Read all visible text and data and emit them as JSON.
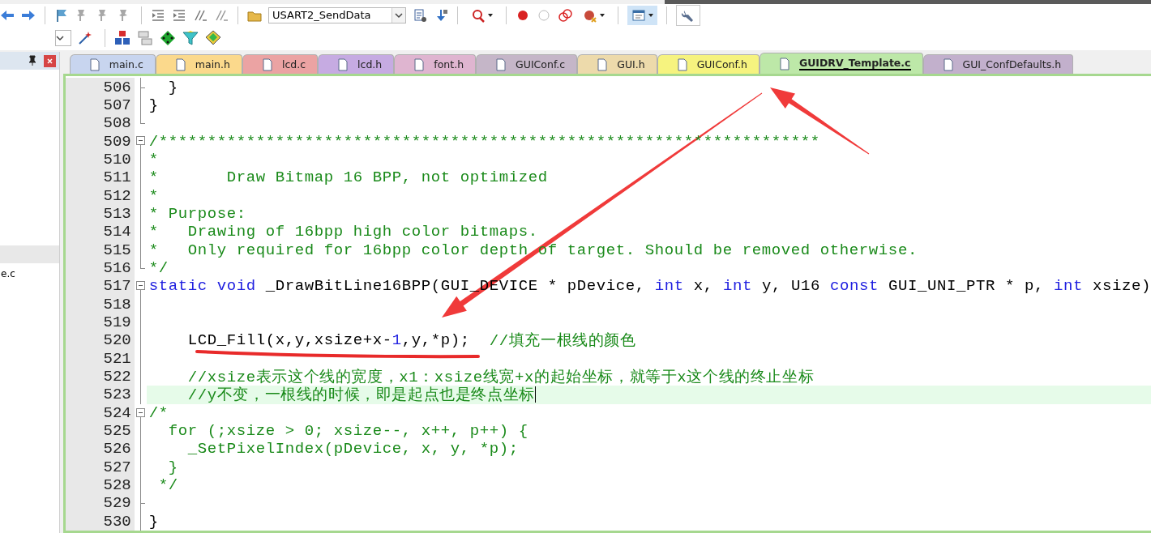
{
  "toolbar": {
    "target": "USART2_SendData",
    "view_toggle_pressed": true
  },
  "project_panel": {
    "items": [
      {
        "label": "e.c"
      }
    ]
  },
  "tabs": [
    {
      "label": "main.c",
      "color": "#c8d5ef",
      "selected": false
    },
    {
      "label": "main.h",
      "color": "#fbd98c",
      "selected": false
    },
    {
      "label": "lcd.c",
      "color": "#eba3a3",
      "selected": false
    },
    {
      "label": "lcd.h",
      "color": "#c6abe2",
      "selected": false
    },
    {
      "label": "font.h",
      "color": "#dfb5d0",
      "selected": false
    },
    {
      "label": "GUIConf.c",
      "color": "#c5b6c8",
      "selected": false
    },
    {
      "label": "GUI.h",
      "color": "#eddaab",
      "selected": false
    },
    {
      "label": "GUIConf.h",
      "color": "#f6f37f",
      "selected": false
    },
    {
      "label": "GUIDRV_Template.c",
      "color": "#bde8a8",
      "selected": true
    },
    {
      "label": "GUI_ConfDefaults.h",
      "color": "#c2b0cc",
      "selected": false
    }
  ],
  "editor": {
    "lines": [
      {
        "number": "506",
        "kind": "tick",
        "current": false,
        "tokens": [
          {
            "kind": "plain",
            "text": "  }"
          }
        ]
      },
      {
        "number": "507",
        "kind": "line",
        "current": false,
        "tokens": [
          {
            "kind": "plain",
            "text": "}"
          }
        ]
      },
      {
        "number": "508",
        "kind": "end",
        "current": false
      },
      {
        "number": "509",
        "kind": "open",
        "current": false,
        "tokens": [
          {
            "kind": "comment",
            "text": "/********************************************************************"
          }
        ]
      },
      {
        "number": "510",
        "kind": "line",
        "current": false,
        "tokens": [
          {
            "kind": "comment",
            "text": "*"
          }
        ]
      },
      {
        "number": "511",
        "kind": "line",
        "current": false,
        "tokens": [
          {
            "kind": "comment",
            "text": "*       Draw Bitmap 16 BPP, not optimized"
          }
        ]
      },
      {
        "number": "512",
        "kind": "line",
        "current": false,
        "tokens": [
          {
            "kind": "comment",
            "text": "*"
          }
        ]
      },
      {
        "number": "513",
        "kind": "line",
        "current": false,
        "tokens": [
          {
            "kind": "comment",
            "text": "* Purpose:"
          }
        ]
      },
      {
        "number": "514",
        "kind": "line",
        "current": false,
        "tokens": [
          {
            "kind": "comment",
            "text": "*   Drawing of 16bpp high color bitmaps."
          }
        ]
      },
      {
        "number": "515",
        "kind": "line",
        "current": false,
        "tokens": [
          {
            "kind": "comment",
            "text": "*   Only required for 16bpp color depth of target. Should be removed otherwise."
          }
        ]
      },
      {
        "number": "516",
        "kind": "end",
        "current": false,
        "tokens": [
          {
            "kind": "comment",
            "text": "*/"
          }
        ]
      },
      {
        "number": "517",
        "kind": "open",
        "current": false,
        "tokens": [
          {
            "kind": "keyword",
            "text": "static void"
          },
          {
            "kind": "plain",
            "text": " _DrawBitLine16BPP(GUI_DEVICE * pDevice, "
          },
          {
            "kind": "keyword",
            "text": "int"
          },
          {
            "kind": "plain",
            "text": " x, "
          },
          {
            "kind": "keyword",
            "text": "int"
          },
          {
            "kind": "plain",
            "text": " y, U16 "
          },
          {
            "kind": "keyword",
            "text": "const"
          },
          {
            "kind": "plain",
            "text": " GUI_UNI_PTR * p, "
          },
          {
            "kind": "keyword",
            "text": "int"
          },
          {
            "kind": "plain",
            "text": " xsize)"
          }
        ]
      },
      {
        "number": "518",
        "kind": "line",
        "current": false
      },
      {
        "number": "519",
        "kind": "line",
        "current": false
      },
      {
        "number": "520",
        "kind": "line",
        "current": false,
        "tokens": [
          {
            "kind": "plain",
            "text": "    LCD_Fill(x,y,xsize+x-"
          },
          {
            "kind": "number",
            "text": "1"
          },
          {
            "kind": "plain",
            "text": ",y,*p);  "
          },
          {
            "kind": "comment",
            "text": "//填充一根线的颜色"
          }
        ]
      },
      {
        "number": "521",
        "kind": "line",
        "current": false
      },
      {
        "number": "522",
        "kind": "line",
        "current": false,
        "tokens": [
          {
            "kind": "comment",
            "text": "    //xsize表示这个线的宽度，x1：xsize线宽+x的起始坐标，就等于x这个线的终止坐标"
          }
        ]
      },
      {
        "number": "523",
        "kind": "line",
        "current": true,
        "tokens": [
          {
            "kind": "comment",
            "text": "    //y不变，一根线的时候，即是起点也是终点坐标"
          }
        ]
      },
      {
        "number": "524",
        "kind": "open",
        "current": false,
        "tokens": [
          {
            "kind": "comment",
            "text": "/*"
          }
        ]
      },
      {
        "number": "525",
        "kind": "line",
        "current": false,
        "tokens": [
          {
            "kind": "comment",
            "text": "  for (;xsize > 0; xsize--, x++, p++) {"
          }
        ]
      },
      {
        "number": "526",
        "kind": "line",
        "current": false,
        "tokens": [
          {
            "kind": "comment",
            "text": "    _SetPixelIndex(pDevice, x, y, *p);"
          }
        ]
      },
      {
        "number": "527",
        "kind": "line",
        "current": false,
        "tokens": [
          {
            "kind": "comment",
            "text": "  }"
          }
        ]
      },
      {
        "number": "528",
        "kind": "line",
        "current": false,
        "tokens": [
          {
            "kind": "comment",
            "text": " */"
          }
        ]
      },
      {
        "number": "529",
        "kind": "tick",
        "current": false
      },
      {
        "number": "530",
        "kind": "line",
        "current": false,
        "tokens": [
          {
            "kind": "plain",
            "text": "}"
          }
        ]
      }
    ]
  },
  "annotations": [
    {
      "kind": "arrow"
    },
    {
      "kind": "arrow"
    },
    {
      "kind": "underline"
    }
  ]
}
